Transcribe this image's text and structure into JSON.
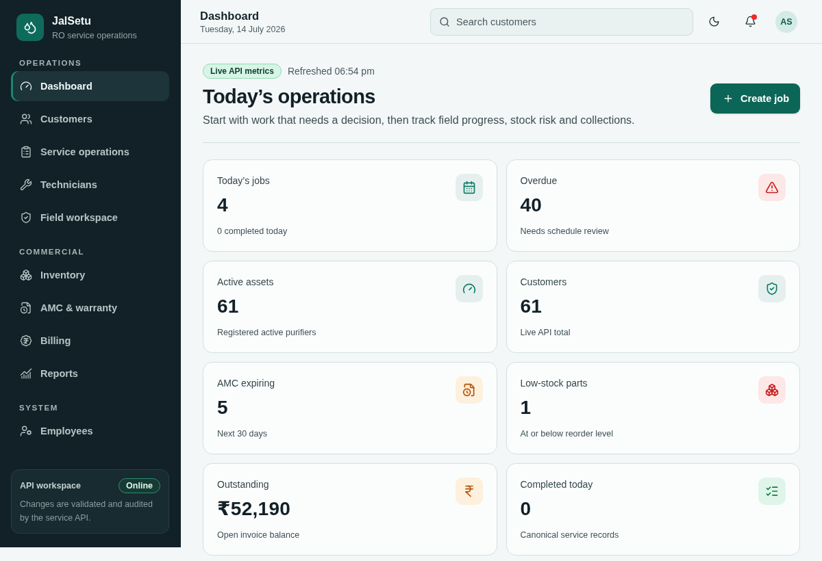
{
  "sidebar": {
    "brand": {
      "name": "JalSetu",
      "tagline": "RO service operations"
    },
    "sections": [
      {
        "title": "OPERATIONS",
        "items": [
          {
            "label": "Dashboard",
            "selected": true
          },
          {
            "label": "Customers",
            "selected": false
          },
          {
            "label": "Service operations",
            "selected": false
          },
          {
            "label": "Technicians",
            "selected": false
          },
          {
            "label": "Field workspace",
            "selected": false
          }
        ]
      },
      {
        "title": "COMMERCIAL",
        "items": [
          {
            "label": "Inventory",
            "selected": false
          },
          {
            "label": "AMC & warranty",
            "selected": false
          },
          {
            "label": "Billing",
            "selected": false
          },
          {
            "label": "Reports",
            "selected": false
          }
        ]
      },
      {
        "title": "SYSTEM",
        "items": [
          {
            "label": "Employees",
            "selected": false
          }
        ]
      }
    ],
    "workspace": {
      "title": "API workspace",
      "status": "Online",
      "note": "Changes are validated and audited by the service API."
    }
  },
  "header": {
    "title": "Dashboard",
    "date": "Tuesday, 14 July 2026",
    "search": {
      "placeholder": "Search customers"
    },
    "notifications": {
      "unread": true
    },
    "avatar": "AS"
  },
  "overview": {
    "badge": "Live API metrics",
    "refreshed": "Refreshed 06:54 pm",
    "title": "Today’s operations",
    "subtitle": "Start with work that needs a decision, then track field progress, stock risk and collections.",
    "primary_button": {
      "label": "Create job"
    }
  },
  "metrics": [
    {
      "label": "Today’s jobs",
      "value": "4",
      "note": "0 completed today",
      "color": "#e5f0ee"
    },
    {
      "label": "Overdue",
      "value": "40",
      "note": "Needs schedule review",
      "color": "#fde7e7"
    },
    {
      "label": "Active assets",
      "value": "61",
      "note": "Registered active purifiers",
      "color": "#e5f0ee"
    },
    {
      "label": "Customers",
      "value": "61",
      "note": "Live API total",
      "color": "#e5f0ee"
    },
    {
      "label": "AMC expiring",
      "value": "5",
      "note": "Next 30 days",
      "color": "#fdf0dd"
    },
    {
      "label": "Low-stock parts",
      "value": "1",
      "note": "At or below reorder level",
      "color": "#fde7e7"
    },
    {
      "label": "Outstanding",
      "value": "₹52,190",
      "note": "Open invoice balance",
      "color": "#fdf0dd"
    },
    {
      "label": "Completed today",
      "value": "0",
      "note": "Canonical service records",
      "color": "#e0f5ea"
    }
  ]
}
